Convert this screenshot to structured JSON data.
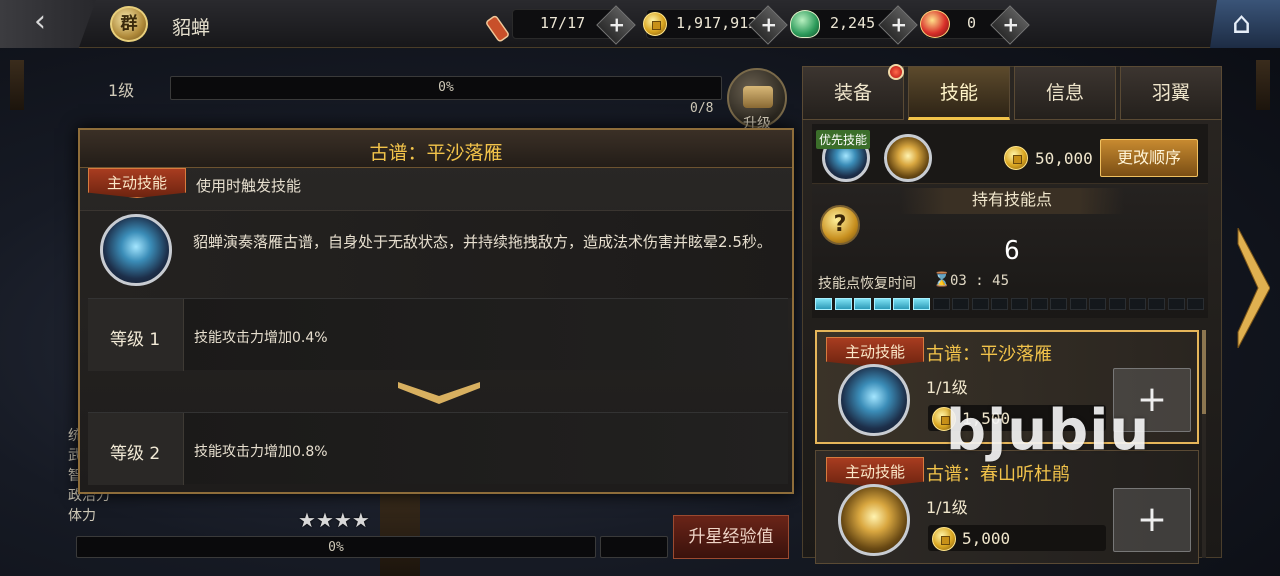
{
  "header": {
    "back_icon": "‹",
    "faction_badge": "群",
    "hero_name": "貂蝉",
    "resources": [
      {
        "name": "stamina",
        "value": "17/17"
      },
      {
        "name": "gold",
        "value": "1,917,912"
      },
      {
        "name": "jade",
        "value": "2,245"
      },
      {
        "name": "ingot",
        "value": "0"
      }
    ],
    "plus": "+",
    "home_icon": "⌂"
  },
  "hero_panel": {
    "level_label": "1级",
    "exp_percent_text": "0%",
    "exp_progress": 0,
    "exp_count": "0/8",
    "upgrade_label": "升级",
    "stat_labels": [
      "统",
      "武",
      "智",
      "政治力",
      "体力"
    ],
    "stars": 4,
    "star_glyph": "★",
    "star_exp_percent_text": "0%",
    "star_exp_button": "升星经验值"
  },
  "popup": {
    "title": "古谱：平沙落雁",
    "skill_tag": "主动技能",
    "trigger_text": "使用时触发技能",
    "description": "貂蝉演奏落雁古谱，自身处于无敌状态，并持续拖拽敌方，造成法术伤害并眩晕2.5秒。",
    "levels": [
      {
        "label": "等级 1",
        "effect": "技能攻击力增加0.4%"
      },
      {
        "label": "等级 2",
        "effect": "技能攻击力增加0.8%"
      }
    ]
  },
  "right_panel": {
    "tabs": [
      {
        "label": "装备",
        "active": false,
        "badge": true
      },
      {
        "label": "技能",
        "active": true,
        "badge": false
      },
      {
        "label": "信息",
        "active": false,
        "badge": false
      },
      {
        "label": "羽翼",
        "active": false,
        "badge": false
      }
    ],
    "priority_tag": "优先技能",
    "change_order_cost": "50,000",
    "change_order_button": "更改顺序",
    "points_title": "持有技能点",
    "help_glyph": "?",
    "points_count": "6",
    "recover_label": "技能点恢复时间",
    "recover_icon": "⌛",
    "recover_time": "03 : 45",
    "points_filled": 6,
    "points_total": 20,
    "skills": [
      {
        "tag": "主动技能",
        "name": "古谱：平沙落雁",
        "level": "1/1级",
        "cost": "1,500",
        "selected": true
      },
      {
        "tag": "主动技能",
        "name": "古谱：春山听杜鹃",
        "level": "1/1级",
        "cost": "5,000",
        "selected": false
      }
    ]
  },
  "watermark": "bjubiu",
  "colors": {
    "accent_gold": "#f2c34a",
    "tag_red": "#a83c20",
    "panel_border": "#8e6d3a"
  }
}
